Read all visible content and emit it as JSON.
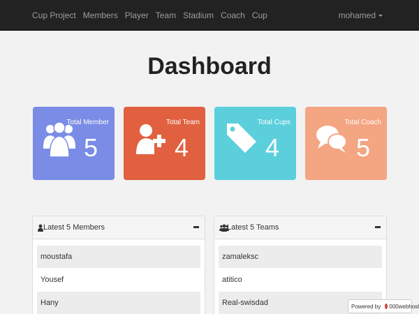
{
  "navbar": {
    "links": [
      "Cup Project",
      "Members",
      "Player",
      "Team",
      "Stadium",
      "Coach",
      "Cup"
    ],
    "user": "mohamed"
  },
  "page": {
    "title": "Dashboard"
  },
  "stats": [
    {
      "label": "Total Member",
      "value": "5",
      "icon": "users-icon",
      "color": "#7a8ce6"
    },
    {
      "label": "Total Team",
      "value": "4",
      "icon": "user-plus-icon",
      "color": "#e0603f"
    },
    {
      "label": "Total Cups",
      "value": "4",
      "icon": "tag-icon",
      "color": "#5bcfdc"
    },
    {
      "label": "Total Coach",
      "value": "5",
      "icon": "chat-bubbles-icon",
      "color": "#f4a582"
    }
  ],
  "members_panel": {
    "title": "Latest 5 Members",
    "items": [
      "moustafa",
      "Yousef",
      "Hany"
    ]
  },
  "teams_panel": {
    "title": "Latest 5 Teams",
    "items": [
      "zamaleksc",
      "atitico",
      "Real-swisdad"
    ]
  },
  "badge": {
    "powered_by": "Powered by",
    "brand": "000webhost"
  }
}
